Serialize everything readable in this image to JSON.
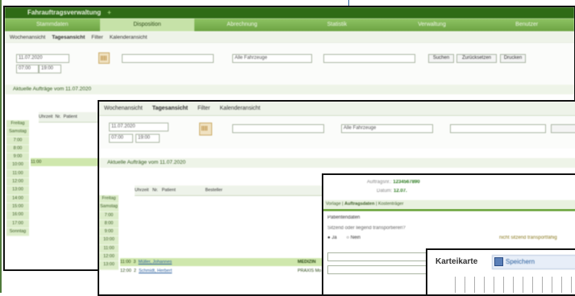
{
  "window1": {
    "title": "Fahrauftragsverwaltung",
    "plus": "+",
    "tabs": [
      "Stammdaten",
      "Disposition",
      "Abrechnung",
      "Statistik",
      "Verwaltung",
      "Benutzer"
    ],
    "active_tab_index": 1,
    "subtabs": [
      "Wochenansicht",
      "Tagesansicht",
      "Filter",
      "Kalenderansicht"
    ],
    "date_value": "11.07.2020",
    "time_from": "07:00",
    "time_to": "19:00",
    "vehicle_value": "Alle Fahrzeuge",
    "buttons": [
      "Suchen",
      "Zurücksetzen",
      "Drucken"
    ],
    "section_label": "Aktuelle Aufträge vom 11.07.2020",
    "grid_header": [
      "Uhrzeit",
      "Nr.",
      "Patient"
    ],
    "grid_times": [
      "Freitag",
      "Samstag",
      "7:00",
      "8:00",
      "9:00",
      "10:00",
      "11:00",
      "12:00",
      "13:00",
      "14:00",
      "15:00",
      "16:00",
      "17:00",
      "Sonntag"
    ],
    "highlight_row": "11:00"
  },
  "window2": {
    "subtabs": [
      "Wochenansicht",
      "Tagesansicht",
      "Filter",
      "Kalenderansicht"
    ],
    "date_value": "11.07.2020",
    "time_from": "07:00",
    "time_to": "19:00",
    "vehicle_value": "Alle Fahrzeuge",
    "section_label": "Aktuelle Aufträge vom 11.07.2020",
    "grid_header": [
      "Uhrzeit",
      "Nr.",
      "Patient",
      "Besteller"
    ],
    "grid_times": [
      "Freitag",
      "Samstag",
      "7:00",
      "8:00",
      "9:00",
      "10:00",
      "11:00",
      "12:00",
      "13:00"
    ],
    "rows": [
      {
        "time": "11:00",
        "nr": "3",
        "patient": "Müller, Johannes",
        "besteller": "MEDIZIN"
      },
      {
        "time": "12:00",
        "nr": "2",
        "patient": "Schmidt, Herbert",
        "besteller": "PRAXIS Mo"
      }
    ]
  },
  "window3": {
    "field1_key": "Auftragsnr.:",
    "field1_value": "1234567890",
    "field2_key": "Datum:",
    "field2_value": "12.07.",
    "nav_items": [
      "Vorlage",
      "Auftragsdaten",
      "Kostenträger"
    ],
    "section_label": "Patientendaten",
    "question_label": "Sitzend oder liegend transportieren?",
    "radio_yes": "Ja",
    "radio_no": "Nein",
    "hint_text": "nicht sitzend transportfähig"
  },
  "window4": {
    "title": "Karteikarte",
    "save_label": "Speichern"
  },
  "colors": {
    "titlebar": "#2f6b16",
    "tabbar": "#7bb04f",
    "highlight": "#cfe7ad",
    "link_text": "#2a7a1e"
  }
}
